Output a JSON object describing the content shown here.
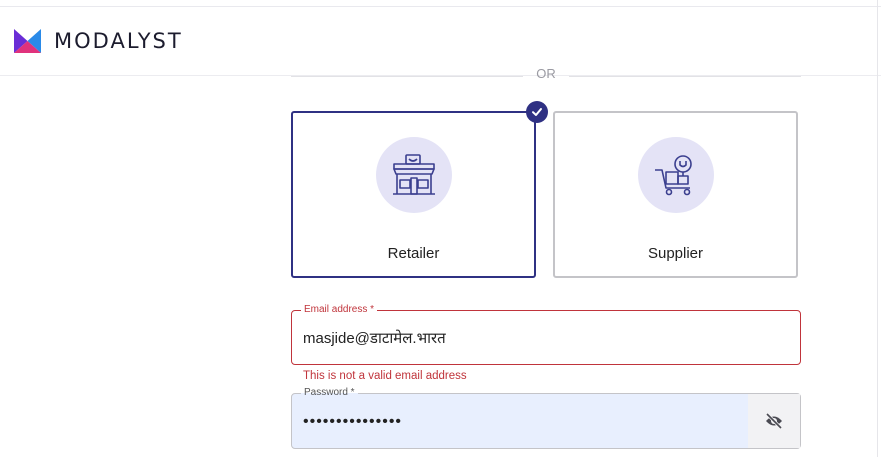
{
  "header": {
    "brand_name": "MODALYST"
  },
  "divider": {
    "text": "OR"
  },
  "roles": [
    {
      "label": "Retailer",
      "selected": true,
      "icon": "storefront-icon"
    },
    {
      "label": "Supplier",
      "selected": false,
      "icon": "cart-with-boxes-icon"
    }
  ],
  "email": {
    "label": "Email address *",
    "value": "masjide@डाटामेल.भारत",
    "error": "This is not a valid email address"
  },
  "password": {
    "label": "Password *",
    "value": "•••••••••••••••",
    "toggle_icon": "eye-slash-icon"
  },
  "colors": {
    "brand": "#2f3183",
    "error": "#c0343b",
    "icon_bg": "#e4e3f6",
    "password_bg": "#e8effe"
  }
}
